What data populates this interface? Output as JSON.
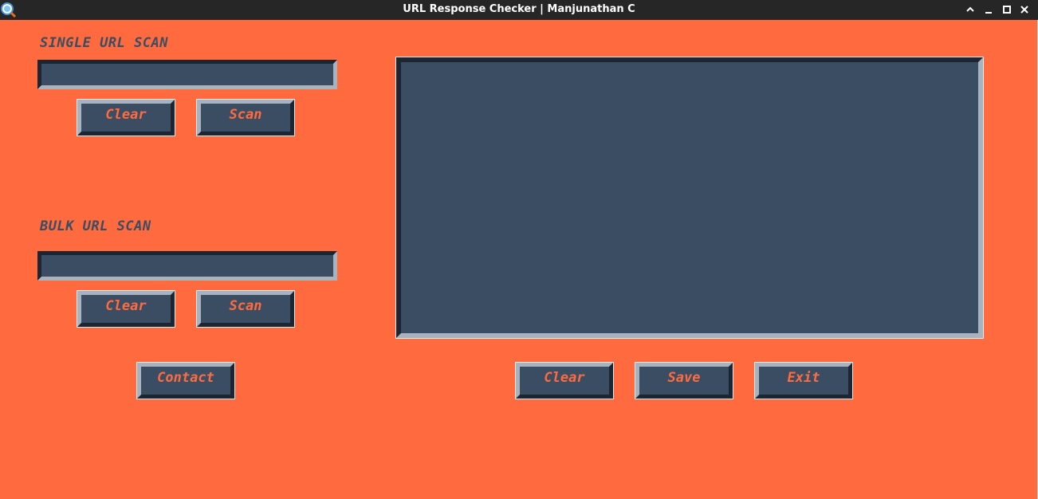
{
  "window": {
    "title": "URL Response Checker | Manjunathan C",
    "app_icon": "magnifier-globe-icon",
    "controls": [
      "chevron-up-icon",
      "minimize-icon",
      "maximize-icon",
      "close-icon"
    ]
  },
  "single_scan": {
    "label": "SINGLE URL SCAN",
    "input_value": "",
    "clear_label": "Clear",
    "scan_label": "Scan"
  },
  "bulk_scan": {
    "label": "BULK URL SCAN",
    "input_value": "",
    "clear_label": "Clear",
    "scan_label": "Scan"
  },
  "contact_label": "Contact",
  "output": {
    "text": "",
    "clear_label": "Clear",
    "save_label": "Save",
    "exit_label": "Exit"
  },
  "colors": {
    "background": "#FF6B3E",
    "widget": "#3B4D63",
    "titlebar": "#262626"
  }
}
